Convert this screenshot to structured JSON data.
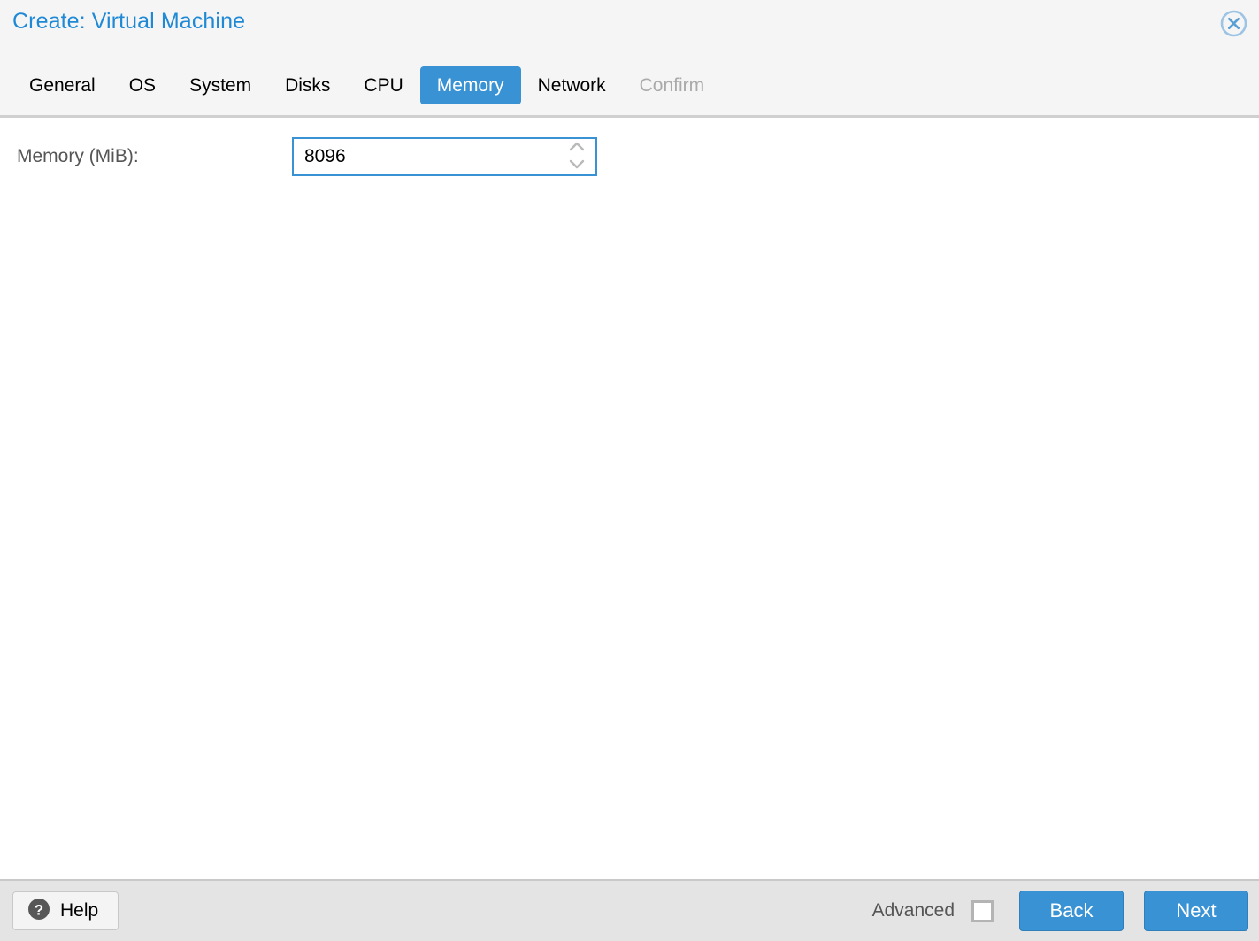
{
  "window": {
    "title": "Create: Virtual Machine",
    "close_icon": "close-circle-icon",
    "accent_color": "#3892d4",
    "title_color": "#1f89d6",
    "header_bg": "#f5f5f5",
    "footer_bg": "#e4e4e4"
  },
  "tabs": [
    {
      "label": "General",
      "state": "normal"
    },
    {
      "label": "OS",
      "state": "normal"
    },
    {
      "label": "System",
      "state": "normal"
    },
    {
      "label": "Disks",
      "state": "normal"
    },
    {
      "label": "CPU",
      "state": "normal"
    },
    {
      "label": "Memory",
      "state": "active"
    },
    {
      "label": "Network",
      "state": "normal"
    },
    {
      "label": "Confirm",
      "state": "disabled"
    }
  ],
  "form": {
    "memory": {
      "label": "Memory (MiB):",
      "value": "8096",
      "placeholder": "",
      "spinner_up_icon": "chevron-up-icon",
      "spinner_down_icon": "chevron-down-icon"
    }
  },
  "footer": {
    "help_label": "Help",
    "help_icon": "question-mark-circle-icon",
    "advanced_label": "Advanced",
    "advanced_checked": false,
    "back_label": "Back",
    "next_label": "Next"
  }
}
